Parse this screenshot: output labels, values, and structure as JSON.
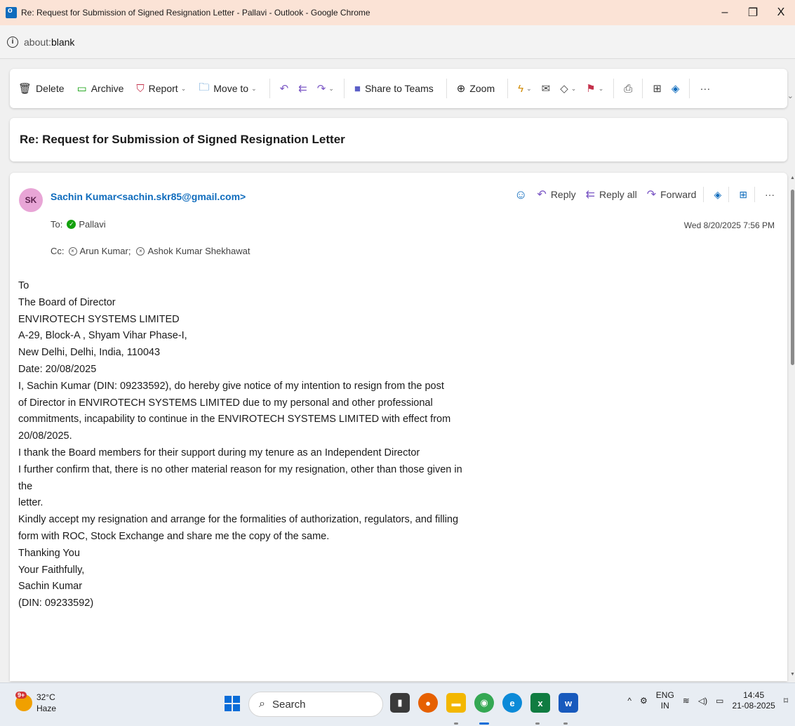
{
  "window": {
    "title": "Re: Request for Submission of Signed Resignation Letter - Pallavi - Outlook - Google Chrome",
    "minimize": "–",
    "restore": "❐",
    "close": "X"
  },
  "address": {
    "prefix": "about:",
    "url": "blank"
  },
  "toolbar": {
    "delete": "Delete",
    "archive": "Archive",
    "report": "Report",
    "move_to": "Move to",
    "share_to_teams": "Share to Teams",
    "zoom": "Zoom",
    "more": "···"
  },
  "subject": "Re: Request for Submission of Signed Resignation Letter",
  "message": {
    "avatar_initials": "SK",
    "sender": "Sachin Kumar<sachin.skr85@gmail.com>",
    "to_label": "To:",
    "to": "Pallavi",
    "cc_label": "Cc:",
    "cc1": "Arun Kumar;",
    "cc2": "Ashok Kumar Shekhawat",
    "date": "Wed 8/20/2025 7:56 PM",
    "actions": {
      "reply": "Reply",
      "reply_all": "Reply all",
      "forward": "Forward",
      "more": "···"
    },
    "body": [
      "To",
      "The Board of Director",
      "ENVIROTECH SYSTEMS LIMITED",
      "A-29, Block-A , Shyam Vihar Phase-I,",
      "New Delhi, Delhi, India, 110043",
      "Date: 20/08/2025",
      "I, Sachin Kumar (DIN: 09233592), do hereby give notice of my intention to resign from the post",
      "of Director in ENVIROTECH SYSTEMS LIMITED due to my personal and other professional",
      "commitments, incapability to continue in the ENVIROTECH SYSTEMS LIMITED with effect from",
      "20/08/2025.",
      "I thank the Board members for their support during my tenure as an Independent Director",
      "I further confirm that, there is no other material reason for my resignation, other than those given in the",
      "letter.",
      "Kindly accept my resignation and arrange for the formalities of authorization, regulators, and filling",
      "form with ROC, Stock Exchange and share me the copy of the same.",
      "Thanking You",
      "Your Faithfully,",
      "Sachin Kumar",
      "(DIN: 09233592)"
    ]
  },
  "taskbar": {
    "weather_badge": "9+",
    "temperature": "32°C",
    "condition": "Haze",
    "search_placeholder": "Search",
    "lang_top": "ENG",
    "lang_bottom": "IN",
    "time": "14:45",
    "date": "21-08-2025"
  },
  "colors": {
    "titlebar_bg": "#fbe3d6",
    "accent": "#0f6cbd",
    "avatar_bg": "#e8a5d6",
    "presence_green": "#13a10e"
  }
}
